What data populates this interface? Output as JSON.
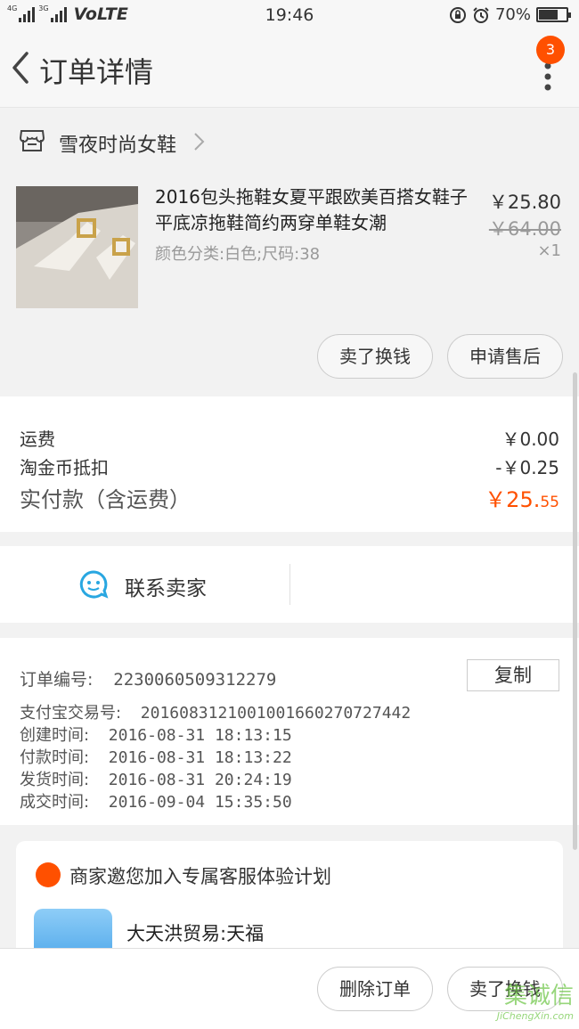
{
  "status_bar": {
    "network": "4G",
    "network2": "3G",
    "volte": "VoLTE",
    "time": "19:46",
    "battery": "70%",
    "battery_level": 0.7
  },
  "header": {
    "title": "订单详情",
    "badge": "3"
  },
  "shop": {
    "name": "雪夜时尚女鞋"
  },
  "product": {
    "title": "2016包头拖鞋女夏平跟欧美百搭女鞋子平底凉拖鞋简约两穿单鞋女潮",
    "sku": "颜色分类:白色;尺码:38",
    "price": "￥25.80",
    "original_price": "￥64.00",
    "quantity": "×1",
    "actions": [
      "卖了换钱",
      "申请售后"
    ]
  },
  "fees": {
    "shipping_label": "运费",
    "shipping_value": "￥0.00",
    "coin_label": "淘金币抵扣",
    "coin_value": "-￥0.25",
    "paid_label": "实付款（含运费）",
    "paid_value_main": "￥25.",
    "paid_value_cents": "55"
  },
  "contact": {
    "label": "联系卖家"
  },
  "order_info": {
    "order_no_label": "订单编号:",
    "order_no": "2230060509312279",
    "copy_label": "复制",
    "alipay_label": "支付宝交易号:",
    "alipay_no": "2016083121001001660270727442",
    "created_label": "创建时间:",
    "created": "2016-08-31 18:13:15",
    "paid_label": "付款时间:",
    "paid": "2016-08-31 18:13:22",
    "shipped_label": "发货时间:",
    "shipped": "2016-08-31 20:24:19",
    "done_label": "成交时间:",
    "done": "2016-09-04 15:35:50"
  },
  "service_card": {
    "title": "商家邀您加入专属客服体验计划",
    "name": "大天洪贸易:天福"
  },
  "bottom_bar": {
    "delete_label": "删除订单",
    "sell_label": "卖了换钱"
  },
  "watermark": {
    "text": "集诚信",
    "sub": "JiChengXin.com"
  },
  "colors": {
    "accent": "#ff5000",
    "contact_icon": "#29a7e1"
  }
}
